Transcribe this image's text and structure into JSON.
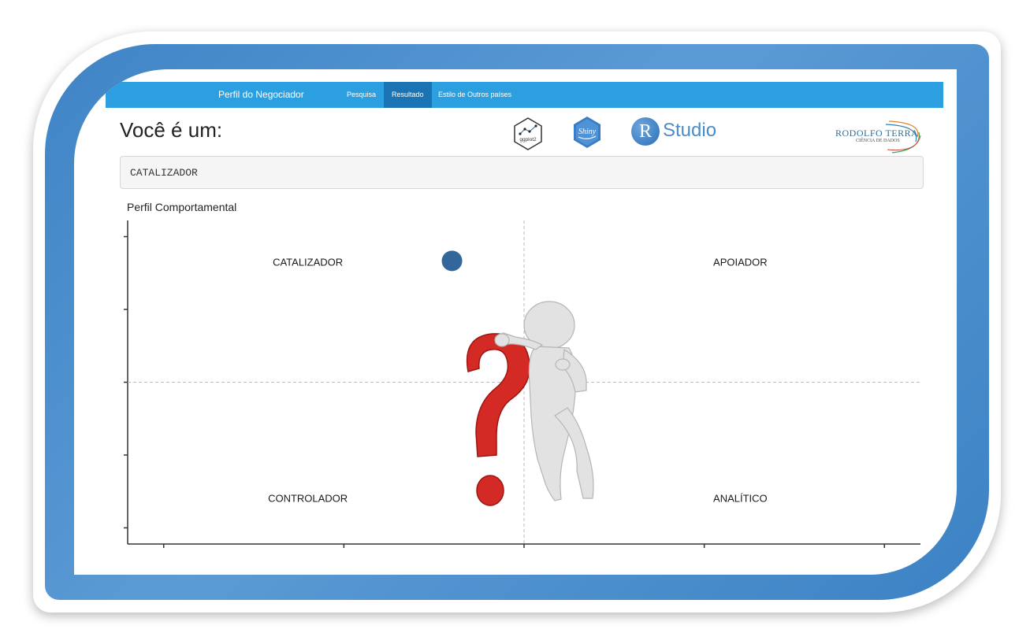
{
  "navbar": {
    "brand": "Perfil do Negociador",
    "tabs": [
      {
        "label": "Pesquisa",
        "active": false
      },
      {
        "label": "Resultado",
        "active": true
      },
      {
        "label": "Estilo de Outros países",
        "active": false
      }
    ]
  },
  "page": {
    "title": "Você é um:",
    "result_value": "CATALIZADOR"
  },
  "logos": {
    "ggplot": "ggplot2",
    "shiny": "Shiny",
    "rstudio_letter": "R",
    "rstudio_text": "Studio",
    "brand_name": "RODOLFO TERRA",
    "brand_sub": "CIÊNCIA DE DADOS"
  },
  "chart_data": {
    "type": "scatter",
    "title": "Perfil Comportamental",
    "quadrant_labels": {
      "top_left": "CATALIZADOR",
      "top_right": "APOIADOR",
      "bottom_left": "CONTROLADOR",
      "bottom_right": "ANALÍTICO"
    },
    "points": [
      {
        "x": -0.4,
        "y": 0.75
      }
    ],
    "xlim": [
      -2.2,
      2.2
    ],
    "ylim": [
      -1.0,
      1.0
    ],
    "reference_lines": {
      "x": 0,
      "y": 0
    },
    "point_color": "#33669a",
    "grid": false
  },
  "colors": {
    "navbar": "#2c9fe0",
    "navbar_active": "#1a74b4",
    "frame": "#4a8ccd"
  }
}
